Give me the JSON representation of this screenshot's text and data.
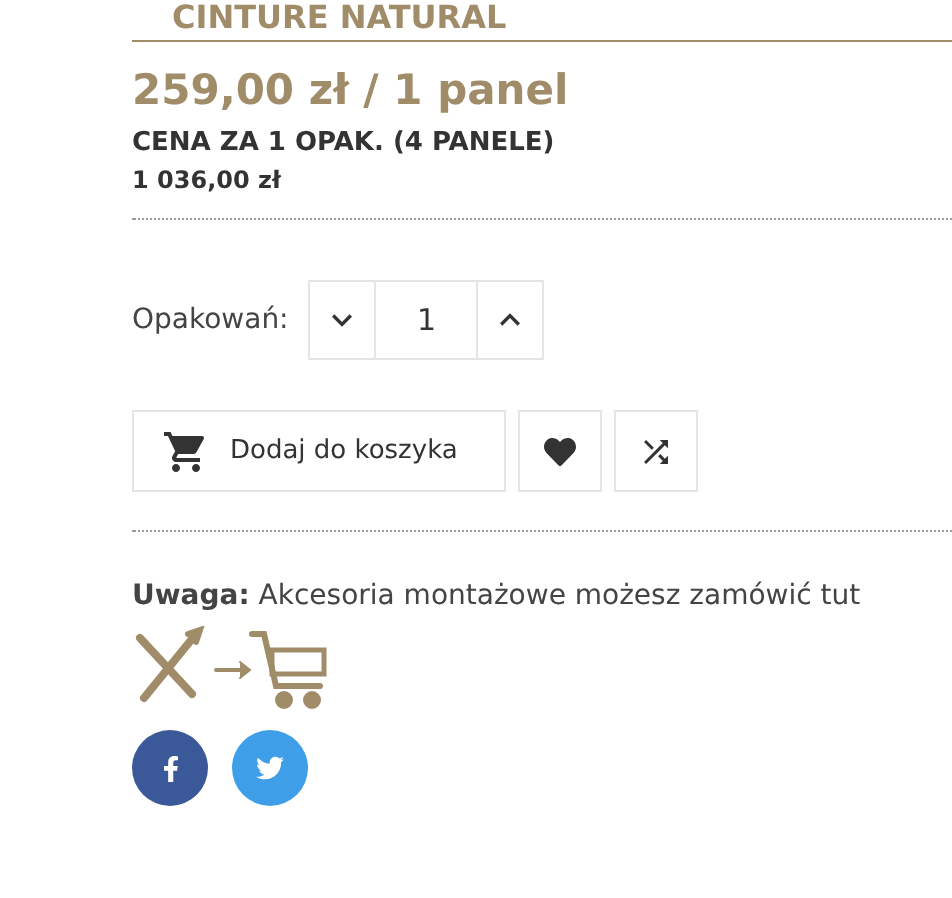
{
  "product_title": "CINTURE NATURAL",
  "price": "259,00 zł / 1 panel",
  "package_price_label": "CENA ZA 1 OPAK. (4 PANELE)",
  "package_price": "1 036,00 zł",
  "quantity": {
    "label": "Opakowań:",
    "value": "1"
  },
  "add_to_cart": "Dodaj do koszyka",
  "note": "**Uwaga:** Akcesoria montażowe możesz zamówić tut",
  "share": [
    {
      "kind": "facebook",
      "color": "#3b5998"
    },
    {
      "kind": "twitter",
      "color": "#3e9ee8"
    }
  ]
}
